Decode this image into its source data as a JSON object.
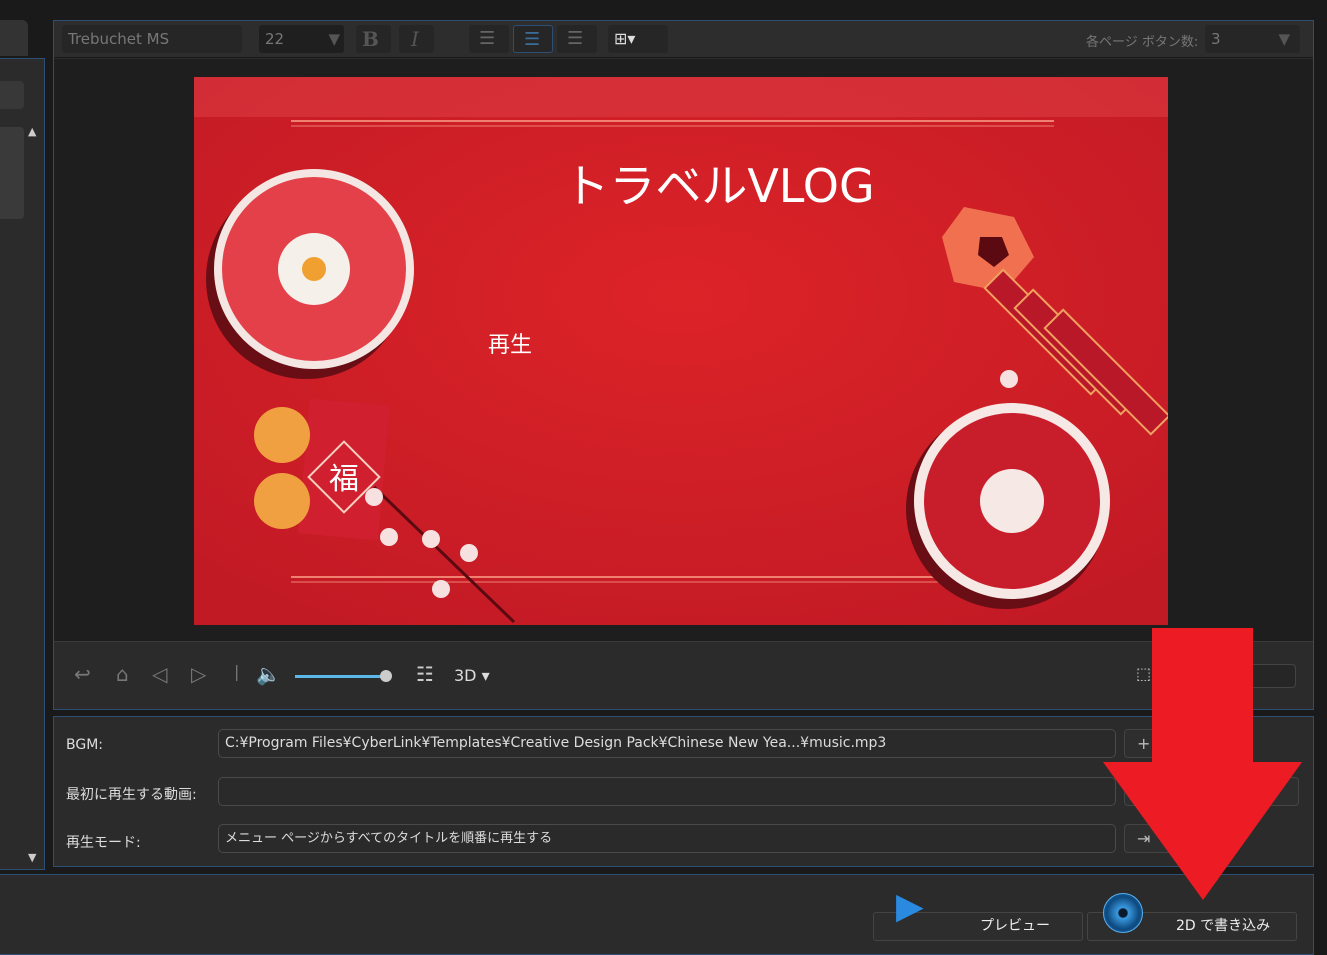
{
  "toolbar": {
    "font": "Trebuchet MS",
    "size": "22",
    "bold": "B",
    "italic": "I",
    "buttons_per_page_label": "各ページ ボタン数:",
    "buttons_per_page": "3"
  },
  "preview": {
    "title": "トラベルVLOG",
    "play": "再生",
    "fu": "福",
    "colors": {
      "bg": "#d9202a",
      "accent": "#f0a060"
    }
  },
  "controls": {
    "mode": "3D",
    "volume": 1.0
  },
  "bgm": {
    "bgm_label": "BGM:",
    "bgm_value": "C:¥Program Files¥CyberLink¥Templates¥Creative Design Pack¥Chinese New Yea...¥music.mp3",
    "first_label": "最初に再生する動画:",
    "first_value": "",
    "mode_label": "再生モード:",
    "mode_value": "メニュー ページからすべてのタイトルを順番に再生する",
    "add": "+"
  },
  "bottom": {
    "preview": "プレビュー",
    "burn": "2D で書き込み"
  },
  "annotation": {
    "arrow_color": "#ed1c24"
  }
}
